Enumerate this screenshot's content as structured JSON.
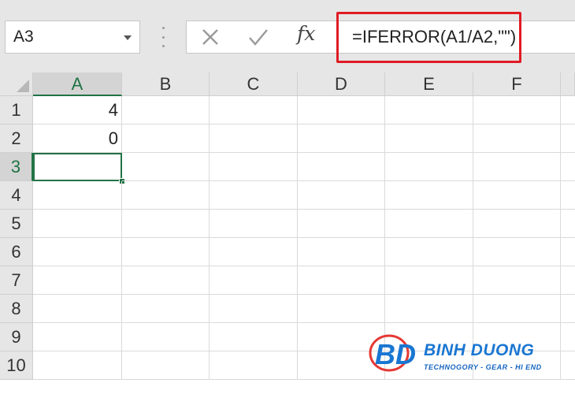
{
  "formula_bar": {
    "name_box": "A3",
    "cancel_icon": "close-icon",
    "enter_icon": "check-icon",
    "function_icon": "fx",
    "formula": "=IFERROR(A1/A2,\"\")",
    "highlight_color": "#e01b24"
  },
  "grid": {
    "columns": [
      "A",
      "B",
      "C",
      "D",
      "E",
      "F"
    ],
    "rows": [
      "1",
      "2",
      "3",
      "4",
      "5",
      "6",
      "7",
      "8",
      "9",
      "10"
    ],
    "cells": {
      "A1": "4",
      "A2": "0",
      "A3": ""
    },
    "active_cell": "A3",
    "accent_color": "#217346"
  },
  "watermark": {
    "name": "BINH DUONG",
    "tagline": "TECHNOGORY - GEAR - HI END"
  }
}
